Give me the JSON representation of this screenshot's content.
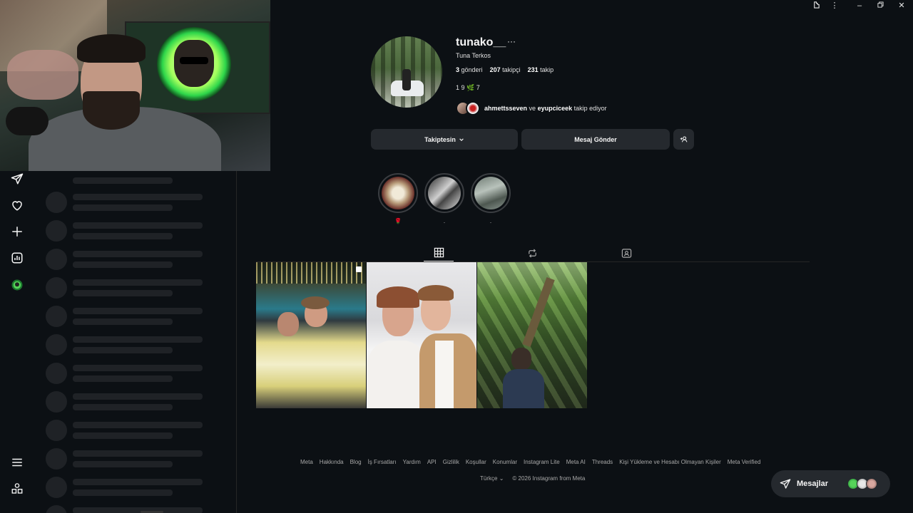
{
  "profile": {
    "username": "tunako__",
    "more_icon": "···",
    "full_name": "Tuna Terkos",
    "stats": {
      "posts_count": "3",
      "posts_label": "gönderi",
      "followers_count": "207",
      "followers_label": "takipçi",
      "following_count": "231",
      "following_label": "takip"
    },
    "bio": {
      "pre": "1 9",
      "leaf": "🌿",
      "post": "7"
    },
    "followed_by": {
      "user1": "ahmettsseven",
      "conj": "ve",
      "user2": "eyupciceek",
      "suffix": "takip ediyor"
    }
  },
  "actions": {
    "following_label": "Takiptesin",
    "message_label": "Mesaj Gönder",
    "suggest_icon": "+person-icon"
  },
  "highlights": [
    {
      "label": "🌹"
    },
    {
      "label": "."
    },
    {
      "label": "."
    }
  ],
  "tabs": [
    "grid-icon",
    "reels-icon",
    "tagged-icon"
  ],
  "footer": {
    "links": [
      "Meta",
      "Hakkında",
      "Blog",
      "İş Fırsatları",
      "Yardım",
      "API",
      "Gizlilik",
      "Koşullar",
      "Konumlar",
      "Instagram Lite",
      "Meta AI",
      "Threads",
      "Kişi Yükleme ve Hesabı Olmayan Kişiler",
      "Meta Verified"
    ],
    "language": "Türkçe",
    "copyright": "© 2026 Instagram from Meta"
  },
  "messages": {
    "label": "Mesajlar"
  },
  "colors": {
    "background": "#0c1014",
    "button": "#25292e",
    "text": "#f5f5f5",
    "muted": "#a8a8a8"
  }
}
